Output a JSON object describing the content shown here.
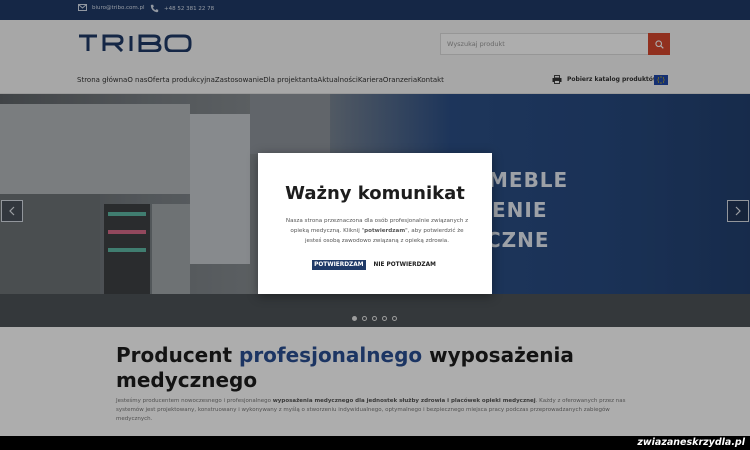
{
  "topbar": {
    "email": "biuro@tribo.com.pl",
    "phone": "+48 52 381 22 78"
  },
  "header": {
    "logo_text": "TRIBO",
    "search_placeholder": "Wyszukaj produkt",
    "nav": [
      "Strona główna",
      "O nas",
      "Oferta produkcyjna",
      "Zastosowanie",
      "Dla projektanta",
      "Aktualności",
      "Kariera",
      "Oranzeria",
      "Kontakt"
    ],
    "catalog_label": "Pobierz katalog produktów"
  },
  "hero": {
    "words": [
      "MEBLE",
      "ENIE",
      "CZNE"
    ],
    "dots_count": 5,
    "active_dot": 0
  },
  "content": {
    "heading_part1": "Producent ",
    "heading_highlight": "profesjonalnego",
    "heading_part2": " wyposażenia medycznego",
    "para_start": "Jesteśmy producentem nowoczesnego i profesjonalnego ",
    "para_bold": "wyposażenia medycznego dla jednostek służby zdrowia i placówek opieki medycznej",
    "para_end": ". Każdy z oferowanych przez nas systemów jest projektowany, konstruowany i wykonywany z myślą o stworzeniu indywidualnego, optymalnego i bezpiecznego miejsca pracy podczas przeprowadzanych zabiegów medycznych."
  },
  "modal": {
    "title": "Ważny komunikat",
    "msg_start": "Nasza strona przeznaczona dla osób profesjonalnie związanych z opieką medyczną. Kliknij \"",
    "msg_bold": "potwierdzam",
    "msg_end": "\", aby potwierdzić że jesteś osobą zawodowo związaną z opieką zdrowia.",
    "confirm_label": "POTWIERDZAM",
    "decline_label": "NIE POTWIERDZAM"
  },
  "watermark": "zwiazaneskrzydla.pl",
  "colors": {
    "brand": "#1f3a68",
    "accent": "#d6472f",
    "highlight": "#2a4e93"
  },
  "icons": [
    "envelope-icon",
    "phone-icon",
    "search-icon",
    "printer-icon",
    "eu-flag-icon",
    "chevron-left-icon",
    "chevron-right-icon"
  ]
}
